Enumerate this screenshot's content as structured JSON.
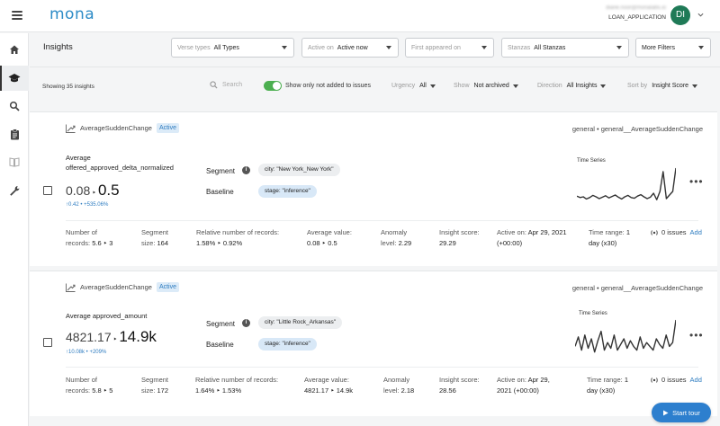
{
  "app": {
    "logo": "mona"
  },
  "user": {
    "email": "diane.noor@monalabs.io",
    "org": "LOAN_APPLICATION",
    "initials": "DI"
  },
  "sidebar": {
    "items": [
      {
        "name": "home",
        "icon": "home-icon"
      },
      {
        "name": "insights",
        "icon": "graduation-cap-icon",
        "active": true
      },
      {
        "name": "search",
        "icon": "magnifier-icon"
      },
      {
        "name": "reports",
        "icon": "clipboard-icon"
      },
      {
        "name": "docs",
        "icon": "book-icon"
      },
      {
        "name": "settings",
        "icon": "wrench-icon"
      }
    ]
  },
  "header": {
    "title": "Insights",
    "filters": [
      {
        "label": "Verse types",
        "value": "All Types"
      },
      {
        "label": "Active on",
        "value": "Active now"
      },
      {
        "label": "First appeared on",
        "value": ""
      },
      {
        "label": "Stanzas",
        "value": "All Stanzas"
      },
      {
        "label": "",
        "value": "More Filters"
      }
    ]
  },
  "toolbar": {
    "count": "Showing 35 insights",
    "search_placeholder": "Search",
    "toggle_label": "Show only not added to issues",
    "urgency": {
      "label": "Urgency",
      "value": "All"
    },
    "show": {
      "label": "Show",
      "value": "Not archived"
    },
    "direction": {
      "label": "Direction",
      "value": "All Insights"
    },
    "sort": {
      "label": "Sort by",
      "value": "Insight Score"
    }
  },
  "cards": [
    {
      "type": "AverageSuddenChange",
      "badge": "Active",
      "path": "general  •  general__AverageSuddenChange",
      "metric_line1": "Average",
      "metric_line2": "offered_approved_delta_normalized",
      "value_from": "0.08",
      "value_to": "0.5",
      "delta": "↑0.42 • +535.06%",
      "segment_label": "Segment",
      "segment_chip": "city: \"New York_New York\"",
      "baseline_label": "Baseline",
      "baseline_chip": "stage: \"inference\"",
      "ts_label": "Time Series",
      "sparkline": [
        0.22,
        0.18,
        0.2,
        0.14,
        0.18,
        0.24,
        0.2,
        0.15,
        0.19,
        0.23,
        0.17,
        0.21,
        0.25,
        0.19,
        0.14,
        0.2,
        0.24,
        0.18,
        0.16,
        0.22,
        0.26,
        0.2,
        0.15,
        0.19,
        0.3,
        0.12,
        0.35,
        0.9,
        0.15,
        0.25,
        0.35,
        1.0
      ],
      "stats": {
        "records_l1": "Number of",
        "records_l2": "records:",
        "records_v": "5.6 ‣ 3",
        "segsize_l1": "Segment",
        "segsize_l2": "size:",
        "segsize_v": "164",
        "rel_l1": "Relative number of records:",
        "rel_v": "1.58% ‣ 0.92%",
        "avg_l1": "Average value:",
        "avg_v": "0.08 ‣ 0.5",
        "anom_l1": "Anomaly",
        "anom_l2": "level:",
        "anom_v": "2.29",
        "score_l1": "Insight score:",
        "score_v": "29.29",
        "active_l1": "Active on:",
        "active_v1": "Apr 29, 2021",
        "active_v2": "(+00:00)",
        "range_l1": "Time range:",
        "range_v1": "1",
        "range_l2": "day (x30)",
        "issues": "0 issues",
        "add": "Add"
      }
    },
    {
      "type": "AverageSuddenChange",
      "badge": "Active",
      "path": "general  •  general__AverageSuddenChange",
      "metric_line1": "Average approved_amount",
      "metric_line2": "",
      "value_from": "4821.17",
      "value_to": "14.9k",
      "delta": "↑10.08k • +209%",
      "segment_label": "Segment",
      "segment_chip": "city: \"Little Rock_Arkansas\"",
      "baseline_label": "Baseline",
      "baseline_chip": "stage: \"inference\"",
      "ts_label": "Time Series",
      "sparkline": [
        0.3,
        0.55,
        0.2,
        0.6,
        0.25,
        0.5,
        0.15,
        0.45,
        0.7,
        0.2,
        0.4,
        0.25,
        0.6,
        0.2,
        0.35,
        0.5,
        0.25,
        0.45,
        0.3,
        0.2,
        0.55,
        0.25,
        0.4,
        0.3,
        0.2,
        0.5,
        0.35,
        0.25,
        0.6,
        0.3,
        0.4,
        1.0
      ],
      "stats": {
        "records_l1": "Number of",
        "records_l2": "records:",
        "records_v": "5.8 ‣ 5",
        "segsize_l1": "Segment",
        "segsize_l2": "size:",
        "segsize_v": "172",
        "rel_l1": "Relative number of records:",
        "rel_v": "1.64% ‣ 1.53%",
        "avg_l1": "Average value:",
        "avg_v": "4821.17 ‣ 14.9k",
        "anom_l1": "Anomaly",
        "anom_l2": "level:",
        "anom_v": "2.18",
        "score_l1": "Insight score:",
        "score_v": "28.56",
        "active_l1": "Active on:",
        "active_v1": "Apr 29,",
        "active_v2": "2021 (+00:00)",
        "range_l1": "Time range:",
        "range_v1": "1",
        "range_l2": "day (x30)",
        "issues": "0 issues",
        "add": "Add"
      }
    }
  ],
  "tour": {
    "label": "Start tour"
  },
  "colors": {
    "brand": "#2e8cc7",
    "avatar": "#1f7a57",
    "toggle": "#4caf50",
    "link": "#2e7cc0",
    "tour": "#2d7fce"
  }
}
